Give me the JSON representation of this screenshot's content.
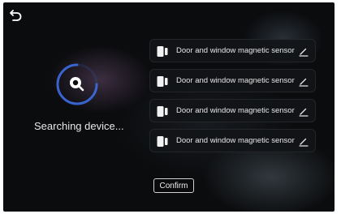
{
  "header": {
    "back_icon": "back-arrow-icon"
  },
  "search": {
    "status_text": "Searching device...",
    "icon": "search-icon"
  },
  "devices": [
    {
      "label": "Door and window magnetic sensor",
      "icon": "door-sensor-icon",
      "action_icon": "edit-icon"
    },
    {
      "label": "Door and window magnetic sensor",
      "icon": "door-sensor-icon",
      "action_icon": "edit-icon"
    },
    {
      "label": "Door and window magnetic sensor",
      "icon": "door-sensor-icon",
      "action_icon": "edit-icon"
    },
    {
      "label": "Door and window magnetic sensor",
      "icon": "door-sensor-icon",
      "action_icon": "edit-icon"
    }
  ],
  "footer": {
    "confirm_label": "Confirm"
  },
  "colors": {
    "accent": "#3d6be0",
    "background": "#0b0c0e",
    "text": "#e6e6e6"
  }
}
